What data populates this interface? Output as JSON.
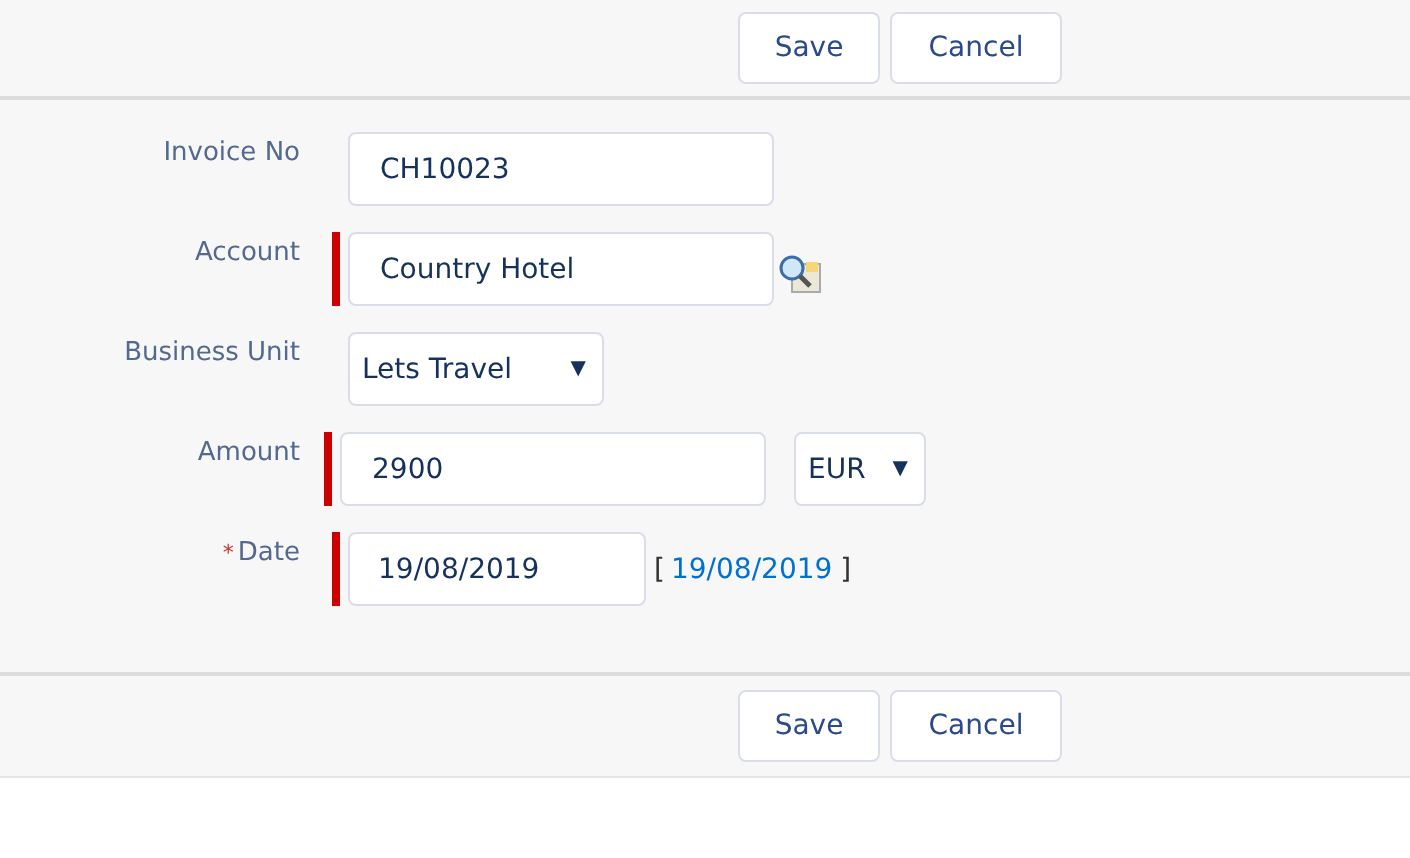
{
  "top_buttons": [
    "Save",
    "Cancel"
  ],
  "fields": [
    {
      "kind": "text",
      "label": "Invoice No",
      "value": "CH10023",
      "required": false
    },
    {
      "kind": "lookup",
      "label": "Account",
      "value": "Country Hotel",
      "required": true
    },
    {
      "kind": "select",
      "label": "Business Unit",
      "value": "Lets Travel",
      "caret": "▼",
      "required": false
    },
    {
      "kind": "amount",
      "label": "Amount",
      "value": "2900",
      "required": true,
      "currency": "EUR",
      "caret": "▼"
    },
    {
      "kind": "date",
      "label": "Date",
      "marker": "*",
      "value": "19/08/2019",
      "required": true,
      "link_open": "[",
      "link": "19/08/2019",
      "link_close": "]"
    }
  ],
  "bottom_buttons": [
    "Save",
    "Cancel"
  ]
}
